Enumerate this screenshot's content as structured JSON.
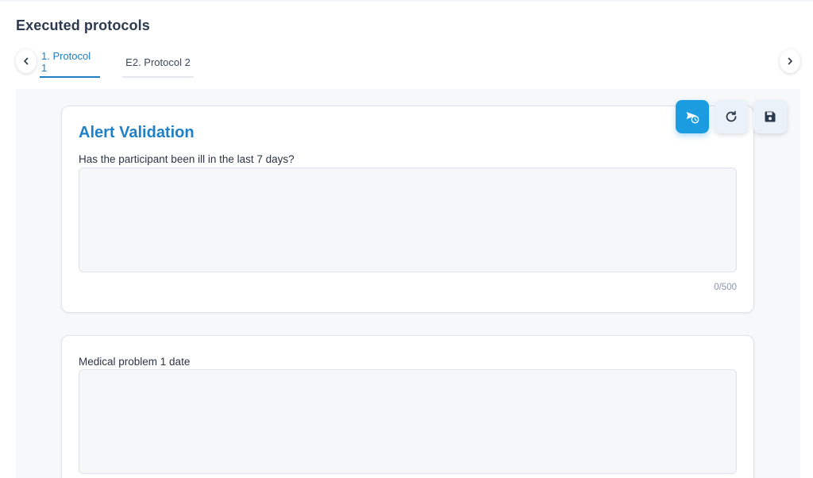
{
  "page": {
    "title": "Executed protocols"
  },
  "tabs": [
    {
      "label": "1. Protocol 1",
      "active": true
    },
    {
      "label": "E2. Protocol 2",
      "active": false
    }
  ],
  "navigation": {
    "prev_icon": "chevron-left-icon",
    "next_icon": "chevron-right-icon"
  },
  "actions": {
    "primary_icon": "send-scheduled-icon",
    "refresh_icon": "refresh-icon",
    "save_icon": "save-icon"
  },
  "cards": [
    {
      "heading": "Alert Validation",
      "field_label": "Has the participant been ill in the last 7 days?",
      "value": "",
      "counter": "0/500"
    },
    {
      "heading": "",
      "field_label": "Medical problem 1 date",
      "value": ""
    }
  ],
  "colors": {
    "accent": "#1f80c5",
    "primary_button": "#1b9be0",
    "content_background": "#f7f8fa"
  }
}
